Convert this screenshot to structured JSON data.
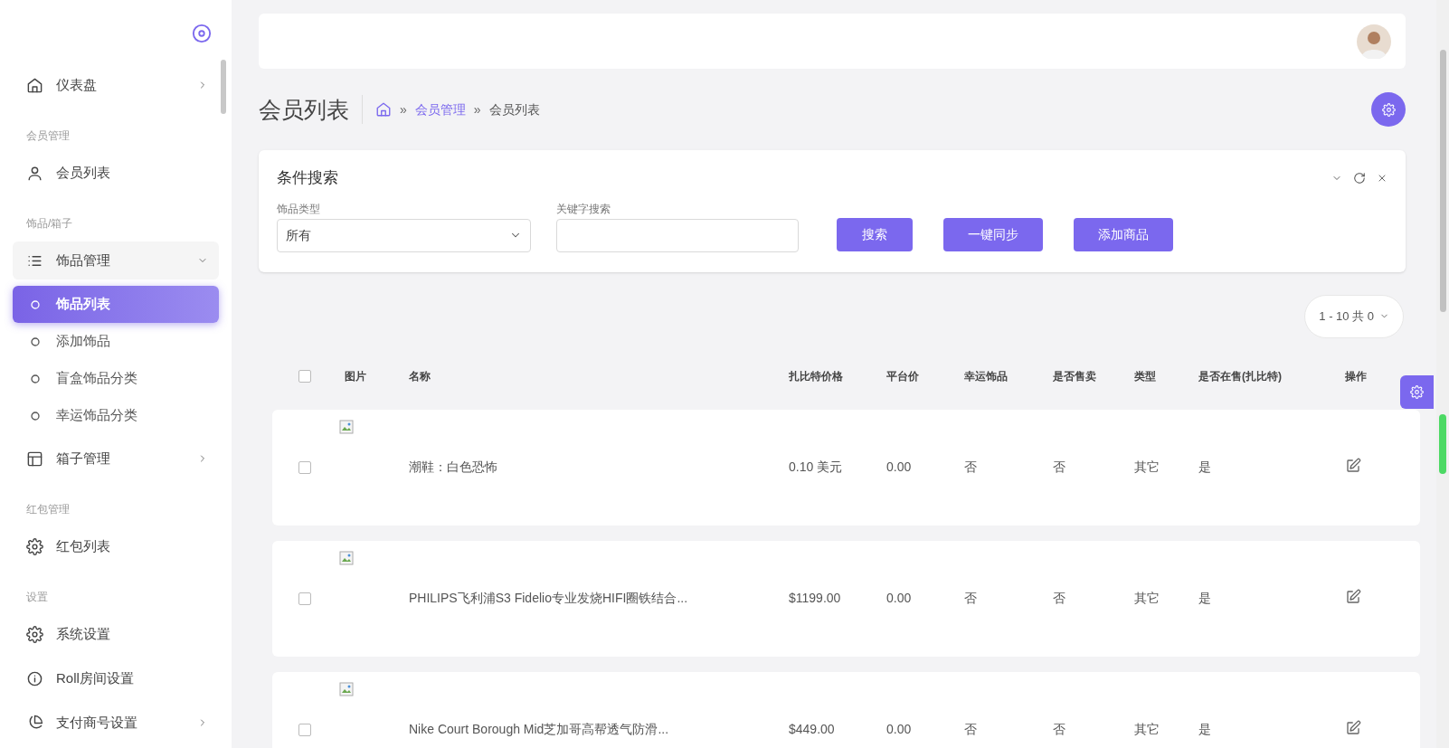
{
  "sidebar": {
    "items": [
      {
        "kind": "item",
        "label": "仪表盘",
        "expanded": false
      },
      {
        "kind": "section",
        "label": "会员管理"
      },
      {
        "kind": "item",
        "label": "会员列表"
      },
      {
        "kind": "section",
        "label": "饰品/箱子"
      },
      {
        "kind": "item",
        "label": "饰品管理",
        "expanded": true,
        "children": [
          {
            "label": "饰品列表",
            "selected": true
          },
          {
            "label": "添加饰品",
            "selected": false
          },
          {
            "label": "盲盒饰品分类",
            "selected": false
          },
          {
            "label": "幸运饰品分类",
            "selected": false
          }
        ]
      },
      {
        "kind": "item",
        "label": "箱子管理",
        "expanded": false
      },
      {
        "kind": "section",
        "label": "红包管理"
      },
      {
        "kind": "item",
        "label": "红包列表"
      },
      {
        "kind": "section",
        "label": "设置"
      },
      {
        "kind": "item",
        "label": "系统设置"
      },
      {
        "kind": "item",
        "label": "Roll房间设置"
      },
      {
        "kind": "item",
        "label": "支付商号设置",
        "expanded": false
      }
    ]
  },
  "page": {
    "title": "会员列表",
    "breadcrumb": [
      {
        "label": "会员管理",
        "link": true
      },
      {
        "label": "会员列表",
        "link": false
      }
    ],
    "separator": "»"
  },
  "search_panel": {
    "title": "条件搜索",
    "category": {
      "label": "饰品类型",
      "value": "所有"
    },
    "keyword": {
      "label": "关键字搜索"
    },
    "buttons": [
      "搜索",
      "一键同步",
      "添加商品"
    ]
  },
  "pagination": {
    "label": "1 - 10 共 0"
  },
  "table": {
    "select_all_checked": false,
    "columns": [
      "图片",
      "名称",
      "扎比特价格",
      "平台价",
      "幸运饰品",
      "是否售卖",
      "类型",
      "是否在售(扎比特)",
      "操作"
    ],
    "rows": [
      {
        "checked": false,
        "name": "潮鞋：白色恐怖",
        "price": "0.10 美元",
        "platform_price": "0.00",
        "lucky": "否",
        "for_sale": "否",
        "type": "其它",
        "on_sale": "是"
      },
      {
        "checked": false,
        "name": "PHILIPS飞利浦S3 Fidelio专业发烧HIFI圈铁结合...",
        "price": "$1199.00",
        "platform_price": "0.00",
        "lucky": "否",
        "for_sale": "否",
        "type": "其它",
        "on_sale": "是"
      },
      {
        "checked": false,
        "name": "Nike Court Borough Mid芝加哥高帮透气防滑...",
        "price": "$449.00",
        "platform_price": "0.00",
        "lucky": "否",
        "for_sale": "否",
        "type": "其它",
        "on_sale": "是"
      }
    ]
  }
}
